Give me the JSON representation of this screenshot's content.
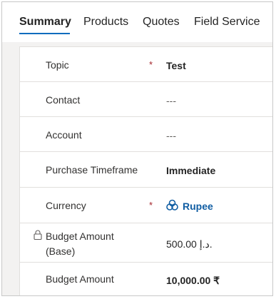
{
  "tabs": [
    {
      "label": "Summary",
      "active": true
    },
    {
      "label": "Products",
      "active": false
    },
    {
      "label": "Quotes",
      "active": false
    },
    {
      "label": "Field Service",
      "active": false
    }
  ],
  "fields": {
    "topic": {
      "label": "Topic",
      "required": "*",
      "value": "Test"
    },
    "contact": {
      "label": "Contact",
      "value": "---"
    },
    "account": {
      "label": "Account",
      "value": "---"
    },
    "purchase_timeframe": {
      "label": "Purchase Timeframe",
      "value": "Immediate"
    },
    "currency": {
      "label": "Currency",
      "required": "*",
      "value": "Rupee"
    },
    "budget_base": {
      "label_line1": "Budget Amount",
      "label_line2": "(Base)",
      "value": "500.00 د.إ."
    },
    "budget_amount": {
      "label": "Budget Amount",
      "value": "10,000.00 ₹"
    }
  },
  "colors": {
    "accent": "#0f6cbd",
    "required": "#a4262c",
    "link": "#115ea3"
  },
  "icons": {
    "lock": "lock-icon",
    "currency": "currency-entity-icon"
  }
}
